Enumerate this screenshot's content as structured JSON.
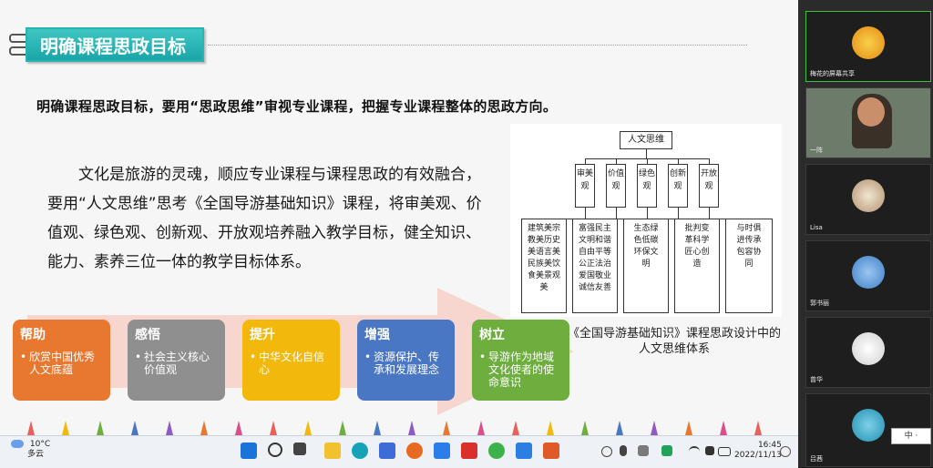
{
  "slide": {
    "title": "明确课程思政目标",
    "headline": "明确课程思政目标，要用“思政思维”审视专业课程，把握专业课程整体的思政方向。",
    "paragraph": "文化是旅游的灵魂，顺应专业课程与课程思政的有效融合，要用“人文思维”思考《全国导游基础知识》课程，将审美观、价值观、绿色观、创新观、开放观培养融入教学目标，健全知识、能力、素养三位一体的教学目标体系。",
    "diagram": {
      "root": "人文思维",
      "branches": [
        "审美观",
        "价值观",
        "绿色观",
        "创新观",
        "开放观"
      ],
      "leaves": [
        "建筑美宗教美历史美语言美民族美饮食美景观美",
        "富强民主文明和谐自由平等公正法治爱国敬业诚信友善",
        "生态绿色低碳环保文明",
        "批判变革科学匠心创造",
        "与时俱进传承包容协同"
      ]
    },
    "caption": "《全国导游基础知识》课程思政设计中的人文思维体系",
    "cards": [
      {
        "title": "帮助",
        "text": "欣赏中国优秀人文底蕴",
        "color": "#e8782f"
      },
      {
        "title": "感悟",
        "text": "社会主义核心价值观",
        "color": "#8f8f8f"
      },
      {
        "title": "提升",
        "text": "中华文化自信心",
        "color": "#f2b90c"
      },
      {
        "title": "增强",
        "text": "资源保护、传承和发展理念",
        "color": "#4a77c4"
      },
      {
        "title": "树立",
        "text": "导游作为地域文化使者的使命意识",
        "color": "#6dae3e"
      }
    ]
  },
  "taskbar": {
    "weather_temp": "10°C",
    "weather_desc": "多云",
    "time": "16:45",
    "date": "2022/11/13"
  },
  "participants": [
    {
      "name": "梅花的屏幕共享"
    },
    {
      "name": "一阵"
    },
    {
      "name": "Lisa"
    },
    {
      "name": "郭书丽"
    },
    {
      "name": "曾华"
    },
    {
      "name": "吕茜"
    }
  ],
  "ime_label": "中 ·"
}
